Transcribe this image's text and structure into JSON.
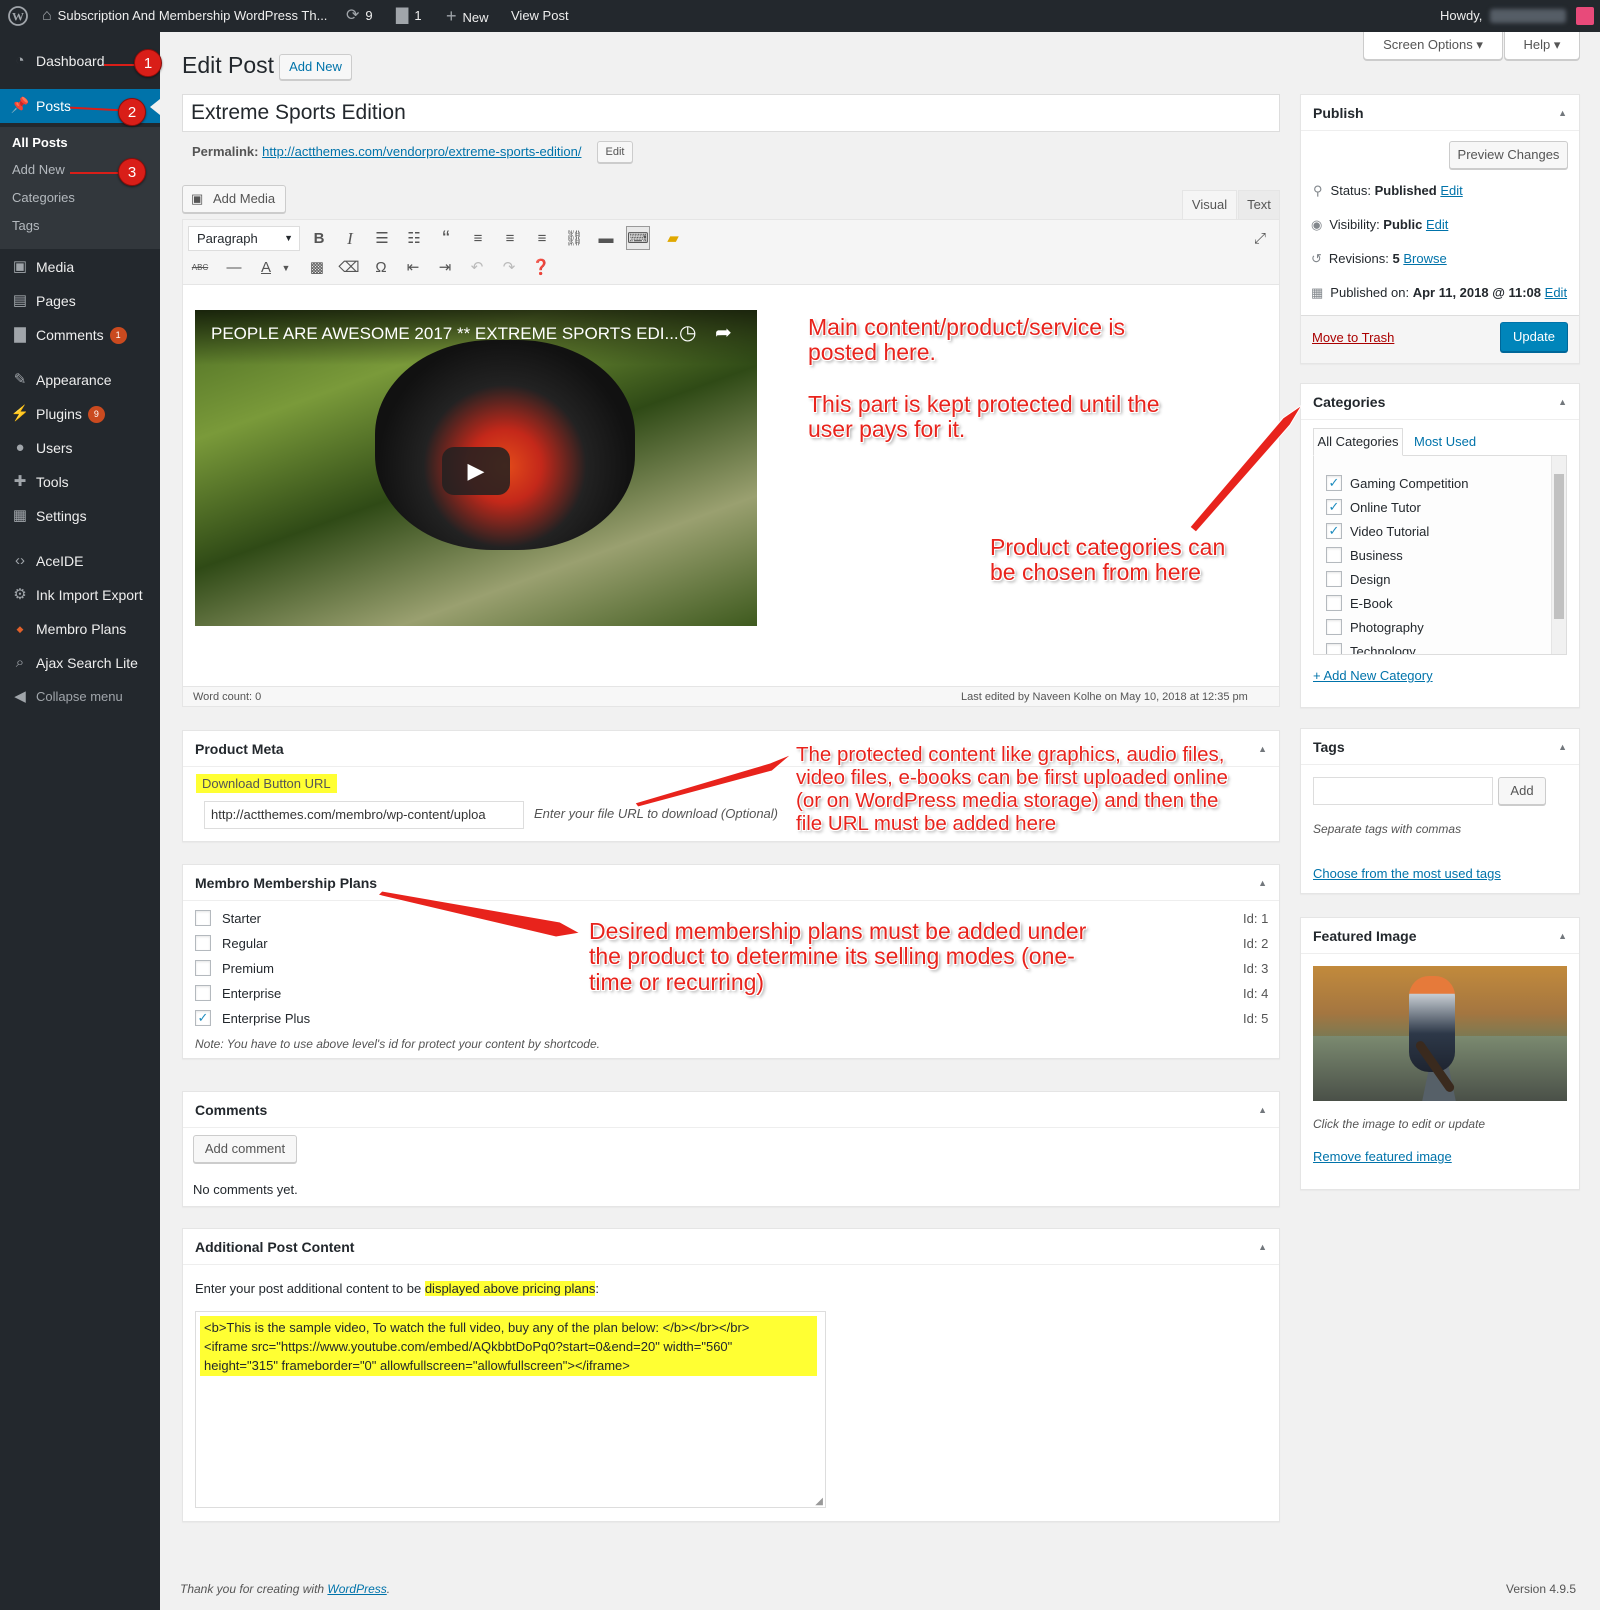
{
  "adminbar": {
    "site_title": "Subscription And Membership WordPress Th...",
    "updates_count": "9",
    "comments_count": "1",
    "new_label": "New",
    "view_post_label": "View Post",
    "howdy": "Howdy,"
  },
  "sidebar": {
    "items": [
      {
        "label": "Dashboard",
        "icon": "dashboard-icon"
      },
      {
        "label": "Posts",
        "icon": "pin-icon"
      },
      {
        "label": "Media",
        "icon": "media-icon"
      },
      {
        "label": "Pages",
        "icon": "pages-icon"
      },
      {
        "label": "Comments",
        "icon": "comment-icon",
        "badge": "1"
      },
      {
        "label": "Appearance",
        "icon": "brush-icon"
      },
      {
        "label": "Plugins",
        "icon": "plug-icon",
        "badge": "9"
      },
      {
        "label": "Users",
        "icon": "user-icon"
      },
      {
        "label": "Tools",
        "icon": "wrench-icon"
      },
      {
        "label": "Settings",
        "icon": "settings-icon"
      },
      {
        "label": "AceIDE",
        "icon": "code-icon"
      },
      {
        "label": "Ink Import Export",
        "icon": "gear-icon"
      },
      {
        "label": "Membro Plans",
        "icon": "membro-icon"
      },
      {
        "label": "Ajax Search Lite",
        "icon": "search-icon"
      },
      {
        "label": "Collapse menu",
        "icon": "collapse-icon"
      }
    ],
    "submenu": [
      "All Posts",
      "Add New",
      "Categories",
      "Tags"
    ],
    "markers": [
      "1",
      "2",
      "3"
    ]
  },
  "screen_options": "Screen Options",
  "help": "Help",
  "page": {
    "title": "Edit Post",
    "add_new": "Add New",
    "post_title": "Extreme Sports Edition",
    "permalink_label": "Permalink:",
    "permalink_url": "http://actthemes.com/vendorpro/extreme-sports-edition/",
    "permalink_edit": "Edit"
  },
  "editor": {
    "add_media": "Add Media",
    "tab_visual": "Visual",
    "tab_text": "Text",
    "format_select": "Paragraph",
    "video_title": "PEOPLE ARE AWESOME 2017 ** EXTREME SPORTS EDI...",
    "word_count": "Word count: 0",
    "last_edited": "Last edited by Naveen Kolhe on May 10, 2018 at 12:35 pm"
  },
  "annotations": {
    "main_content": "Main content/product/service is posted here.",
    "protected": "This part is kept protected until the user pays for it.",
    "categories": "Product categories can be chosen from here",
    "protected_files": "The protected content like graphics, audio files, video files, e-books can be first uploaded online (or on WordPress media storage) and then the file URL must be added here",
    "plans": "Desired membership plans must be added under the product to determine its selling modes (one-time or recurring)"
  },
  "product_meta": {
    "title": "Product Meta",
    "field_label": "Download Button URL",
    "field_value": "http://actthemes.com/membro/wp-content/uploa",
    "hint": "Enter your file URL to download (Optional)"
  },
  "plans": {
    "title": "Membro Membership Plans",
    "items": [
      {
        "label": "Starter",
        "id": "Id: 1",
        "checked": false
      },
      {
        "label": "Regular",
        "id": "Id: 2",
        "checked": false
      },
      {
        "label": "Premium",
        "id": "Id: 3",
        "checked": false
      },
      {
        "label": "Enterprise",
        "id": "Id: 4",
        "checked": false
      },
      {
        "label": "Enterprise Plus",
        "id": "Id: 5",
        "checked": true
      }
    ],
    "note": "Note: You have to use above level's id for protect your content by shortcode."
  },
  "comments": {
    "title": "Comments",
    "add_comment": "Add comment",
    "none": "No comments yet."
  },
  "additional": {
    "title": "Additional Post Content",
    "intro_prefix": "Enter your post additional content to be ",
    "intro_highlight": "displayed above pricing plans",
    "intro_suffix": ":",
    "line1": "<b>This is the sample video, To watch the full video, buy any of the plan below: </b></br></br>",
    "line2": "<iframe src=\"https://www.youtube.com/embed/AQkbbtDoPq0?start=0&end=20\" width=\"560\"",
    "line3": "height=\"315\" frameborder=\"0\" allowfullscreen=\"allowfullscreen\"></iframe>"
  },
  "publish": {
    "title": "Publish",
    "preview": "Preview Changes",
    "status_label": "Status: ",
    "status_value": "Published",
    "visibility_label": "Visibility: ",
    "visibility_value": "Public",
    "revisions_label": "Revisions: ",
    "revisions_value": "5",
    "browse": "Browse",
    "published_label": "Published on: ",
    "published_value": "Apr 11, 2018 @ 11:08",
    "edit": "Edit",
    "trash": "Move to Trash",
    "update": "Update"
  },
  "categories": {
    "title": "Categories",
    "tab_all": "All Categories",
    "tab_used": "Most Used",
    "items": [
      {
        "label": "Gaming Competition",
        "checked": true
      },
      {
        "label": "Online Tutor",
        "checked": true
      },
      {
        "label": "Video Tutorial",
        "checked": true
      },
      {
        "label": "Business",
        "checked": false
      },
      {
        "label": "Design",
        "checked": false
      },
      {
        "label": "E-Book",
        "checked": false
      },
      {
        "label": "Photography",
        "checked": false
      },
      {
        "label": "Technology",
        "checked": false
      }
    ],
    "add_new": "+ Add New Category"
  },
  "tags": {
    "title": "Tags",
    "add": "Add",
    "hint": "Separate tags with commas",
    "choose": "Choose from the most used tags"
  },
  "featured": {
    "title": "Featured Image",
    "hint": "Click the image to edit or update",
    "remove": "Remove featured image"
  },
  "footer": {
    "thanks_prefix": "Thank you for creating with ",
    "wordpress": "WordPress",
    "thanks_suffix": ".",
    "version": "Version 4.9.5"
  },
  "colors": {
    "admin_bar": "#23282d",
    "accent": "#0073aa",
    "annotation": "#e8231c",
    "highlight": "#ffff33"
  }
}
